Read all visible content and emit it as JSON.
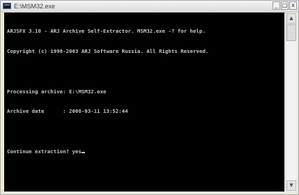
{
  "window": {
    "title": "E:\\MSM32.exe",
    "minimize_label": "_",
    "maximize_label": "□",
    "close_label": "x"
  },
  "console": {
    "lines": [
      "ARJSFX 3.10 - ARJ Archive Self-Extractor. MSM32.exe -? for help.",
      "Copyright (c) 1998-2003 ARJ Software Russia. All Rights Reserved.",
      "",
      "Processing archive: E:\\MSM32.exe",
      "Archive date      : 2008-03-11 13:52:44",
      "",
      "Continue extraction? yes"
    ]
  },
  "scrollbar": {
    "up_icon": "▲",
    "down_icon": "▼"
  }
}
